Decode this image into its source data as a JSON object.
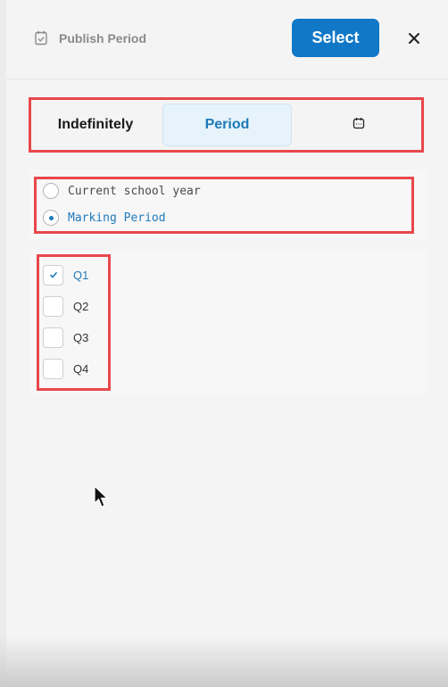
{
  "header": {
    "title": "Publish Period",
    "icon": "calendar-check-icon",
    "select_label": "Select",
    "close_icon": "close-icon"
  },
  "tabs": [
    {
      "label": "Indefinitely",
      "selected": false
    },
    {
      "label": "Period",
      "selected": true
    },
    {
      "label": "",
      "icon": "calendar-icon",
      "selected": false
    }
  ],
  "period_options": [
    {
      "label": "Current school year",
      "selected": false
    },
    {
      "label": "Marking Period",
      "selected": true
    }
  ],
  "marking_periods": [
    {
      "label": "Q1",
      "checked": true
    },
    {
      "label": "Q2",
      "checked": false
    },
    {
      "label": "Q3",
      "checked": false
    },
    {
      "label": "Q4",
      "checked": false
    }
  ],
  "colors": {
    "accent": "#1178c8",
    "selected_text": "#1d7ab8",
    "highlight_box": "#e8474b"
  }
}
